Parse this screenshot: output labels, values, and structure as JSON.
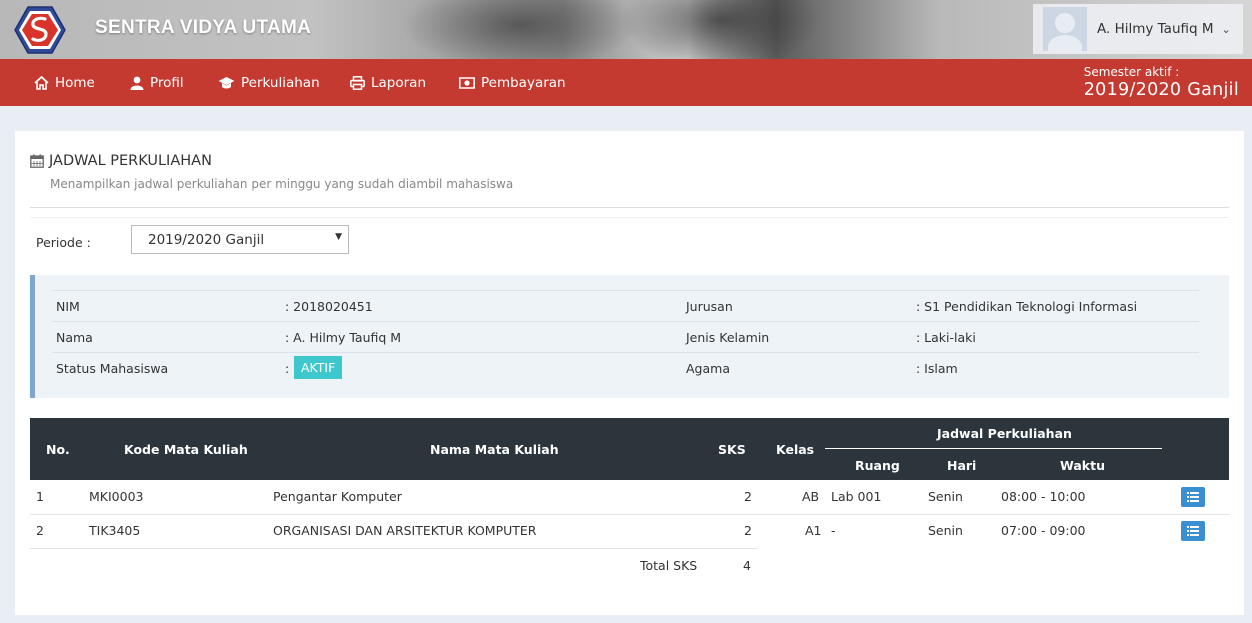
{
  "header": {
    "brand": "SENTRA VIDYA UTAMA",
    "user_name": "A. Hilmy Taufiq M"
  },
  "nav": {
    "items": [
      {
        "label": "Home",
        "icon": "home-icon"
      },
      {
        "label": "Profil",
        "icon": "user-icon"
      },
      {
        "label": "Perkuliahan",
        "icon": "graduation-cap-icon"
      },
      {
        "label": "Laporan",
        "icon": "printer-icon"
      },
      {
        "label": "Pembayaran",
        "icon": "money-icon"
      }
    ],
    "semester_label": "Semester aktif :",
    "semester_value": "2019/2020 Ganjil"
  },
  "page": {
    "title": "JADWAL PERKULIAHAN",
    "subtitle": "Menampilkan jadwal perkuliahan per minggu yang sudah diambil mahasiswa",
    "periode_label": "Periode :",
    "periode_value": "2019/2020 Ganjil"
  },
  "student": {
    "nim_label": "NIM",
    "nim": ": 2018020451",
    "nama_label": "Nama",
    "nama": ": A. Hilmy Taufiq M",
    "status_label": "Status Mahasiswa",
    "status_colon": ":",
    "status": "AKTIF",
    "jurusan_label": "Jurusan",
    "jurusan": ": S1 Pendidikan Teknologi Informasi",
    "jk_label": "Jenis Kelamin",
    "jk": ": Laki-laki",
    "agama_label": "Agama",
    "agama": ": Islam",
    "status_color": "#3ec7cd"
  },
  "table": {
    "headers": {
      "no": "No.",
      "kode": "Kode Mata Kuliah",
      "nama": "Nama Mata Kuliah",
      "sks": "SKS",
      "kelas": "Kelas",
      "jadwal": "Jadwal Perkuliahan",
      "ruang": "Ruang",
      "hari": "Hari",
      "waktu": "Waktu"
    },
    "rows": [
      {
        "no": "1",
        "kode": "MKI0003",
        "nama": "Pengantar Komputer",
        "sks": "2",
        "kelas": "AB",
        "ruang": "Lab 001",
        "hari": "Senin",
        "waktu": "08:00 - 10:00"
      },
      {
        "no": "2",
        "kode": "TIK3405",
        "nama": "ORGANISASI DAN ARSITEKTUR KOMPUTER",
        "sks": "2",
        "kelas": "A1",
        "ruang": "-",
        "hari": "Senin",
        "waktu": "07:00 - 09:00"
      }
    ],
    "total_label": "Total SKS",
    "total_value": "4"
  },
  "colors": {
    "nav_bg": "#c43a30",
    "table_header_bg": "#2c343c",
    "detail_button": "#3a8fd1"
  }
}
